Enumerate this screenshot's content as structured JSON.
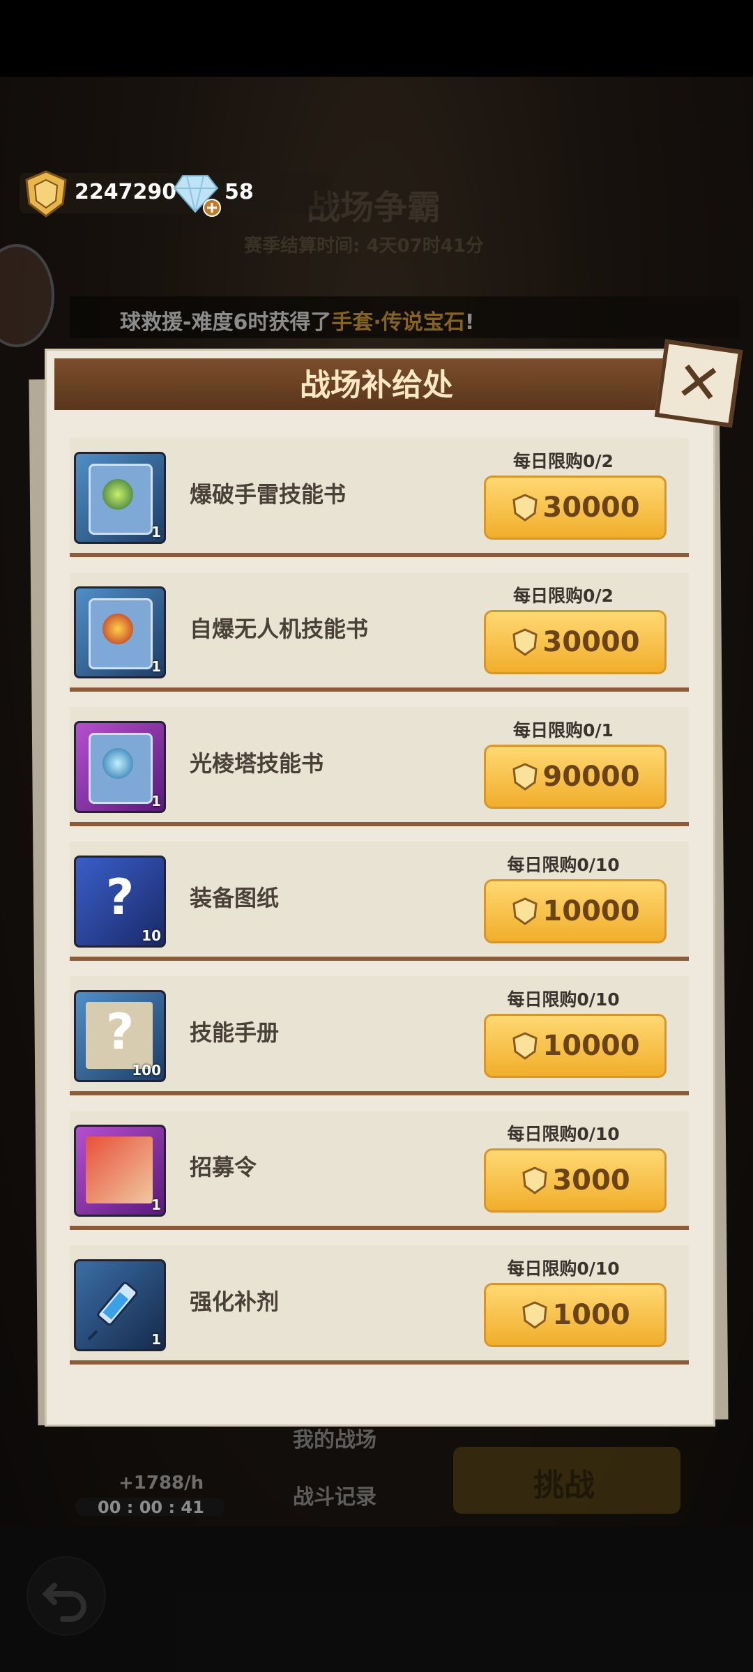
{
  "currency": {
    "coins": "2247290",
    "gems": "58"
  },
  "background": {
    "title": "战场争霸",
    "season": "赛季结算时间: 4天07时41分",
    "marquee_prefix": "球救援-难度6时获得了",
    "marquee_highlight": "手套·传说宝石",
    "marquee_suffix": "!",
    "my_battle": "我的战场",
    "battle_record": "战斗记录",
    "rate": "+1788/h",
    "timer": "00 : 00 : 41",
    "challenge": "挑战"
  },
  "shop": {
    "title": "战场补给处",
    "items": [
      {
        "name": "爆破手雷技能书",
        "count": "1",
        "limit": "每日限购0/2",
        "price": "30000",
        "frame": "blue",
        "icon": "grenade-skill-book-icon"
      },
      {
        "name": "自爆无人机技能书",
        "count": "1",
        "limit": "每日限购0/2",
        "price": "30000",
        "frame": "blue",
        "icon": "drone-skill-book-icon"
      },
      {
        "name": "光棱塔技能书",
        "count": "1",
        "limit": "每日限购0/1",
        "price": "90000",
        "frame": "purple",
        "icon": "prism-tower-skill-book-icon"
      },
      {
        "name": "装备图纸",
        "count": "10",
        "limit": "每日限购0/10",
        "price": "10000",
        "frame": "blue",
        "icon": "equipment-blueprint-icon"
      },
      {
        "name": "技能手册",
        "count": "100",
        "limit": "每日限购0/10",
        "price": "10000",
        "frame": "blue",
        "icon": "skill-manual-icon"
      },
      {
        "name": "招募令",
        "count": "1",
        "limit": "每日限购0/10",
        "price": "3000",
        "frame": "purple",
        "icon": "recruit-order-icon"
      },
      {
        "name": "强化补剂",
        "count": "1",
        "limit": "每日限购0/10",
        "price": "1000",
        "frame": "blue",
        "icon": "enhancement-syringe-icon"
      }
    ]
  }
}
